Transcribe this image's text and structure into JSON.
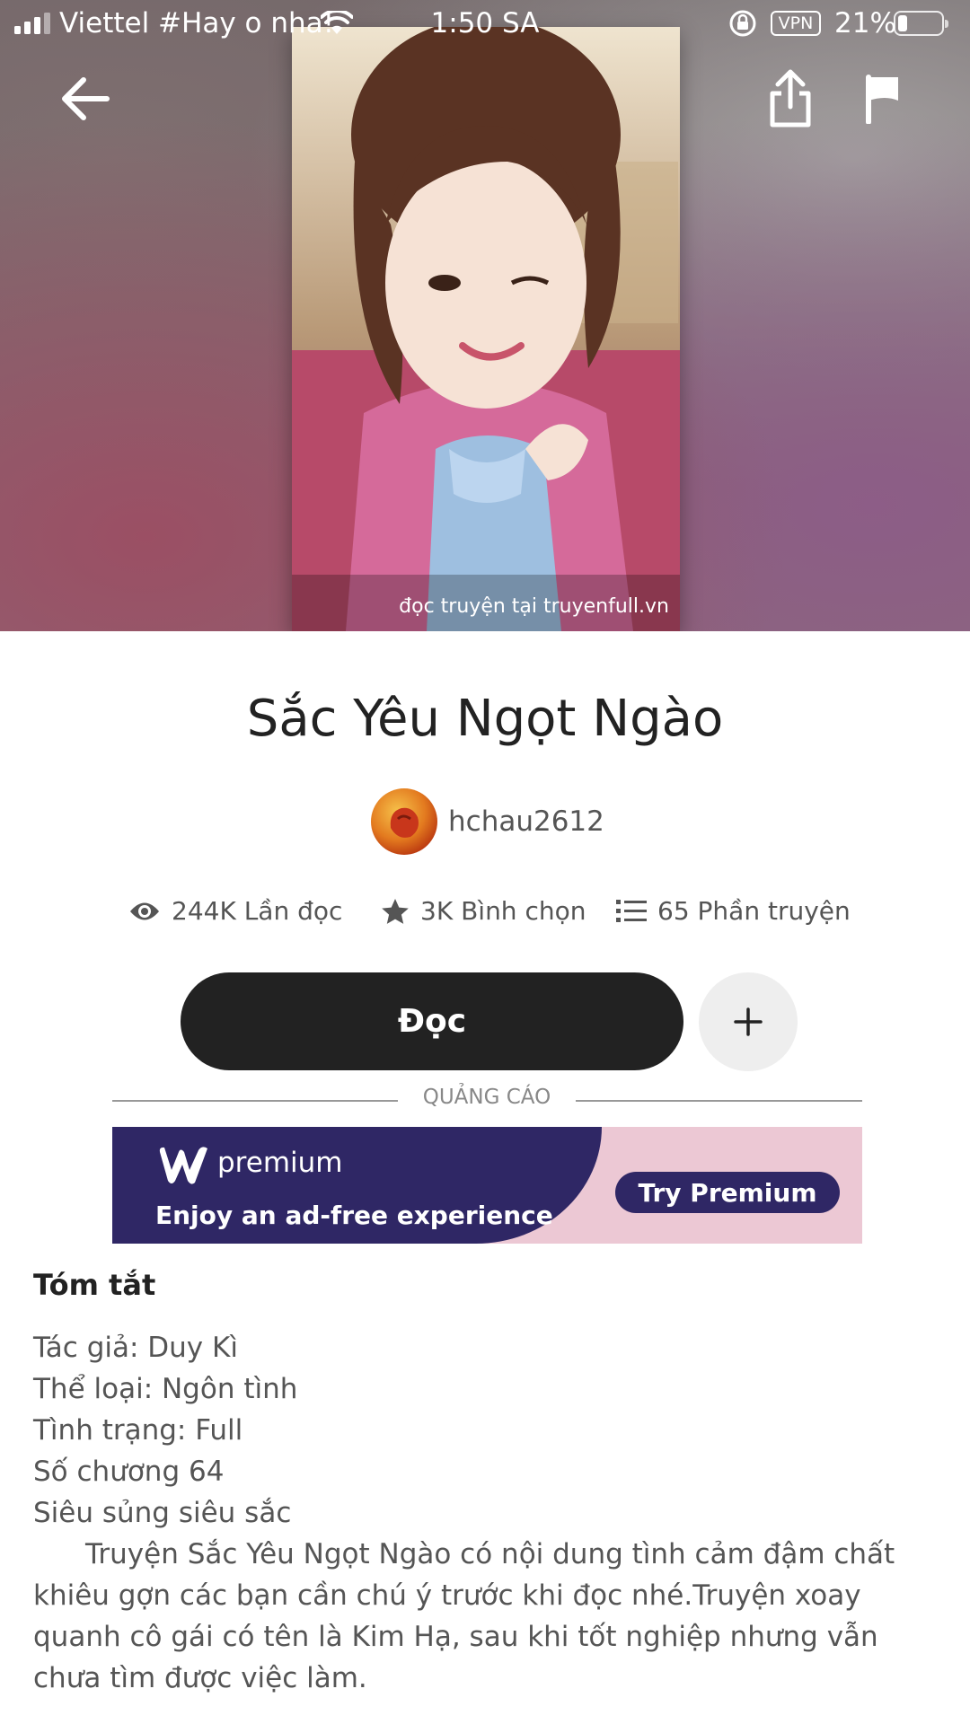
{
  "status_bar": {
    "carrier": "Viettel #Hay o nha!",
    "time": "1:50 SA",
    "vpn": "VPN",
    "battery": "21%",
    "battery_level": 0.21
  },
  "cover": {
    "watermark": "đọc truyện tại truyenfull.vn"
  },
  "story": {
    "title": "Sắc Yêu Ngọt Ngào",
    "author": "hchau2612"
  },
  "stats": {
    "reads": "244K Lần đọc",
    "votes": "3K Bình chọn",
    "parts": "65 Phần truyện"
  },
  "actions": {
    "read_label": "Đọc",
    "add_label": "+"
  },
  "ad": {
    "label": "QUẢNG CÁO",
    "premium_word": "premium",
    "tagline": "Enjoy an ad-free experience",
    "cta": "Try Premium",
    "colors": {
      "dark": "#2f2765",
      "pink": "#ecc8d4"
    }
  },
  "summary": {
    "heading": "Tóm tắt",
    "lines": [
      "Tác giả: Duy Kì",
      "Thể loại: Ngôn tình",
      "Tình trạng: Full",
      "Số chương 64",
      "Siêu sủng siêu sắc"
    ],
    "paragraph": "Truyện Sắc Yêu Ngọt Ngào có nội dung tình cảm đậm chất khiêu gợn các bạn cần chú ý trước khi đọc nhé.Truyện xoay quanh cô gái có tên là Kim Hạ, sau khi tốt nghiệp nhưng vẫn chưa tìm được việc làm."
  }
}
